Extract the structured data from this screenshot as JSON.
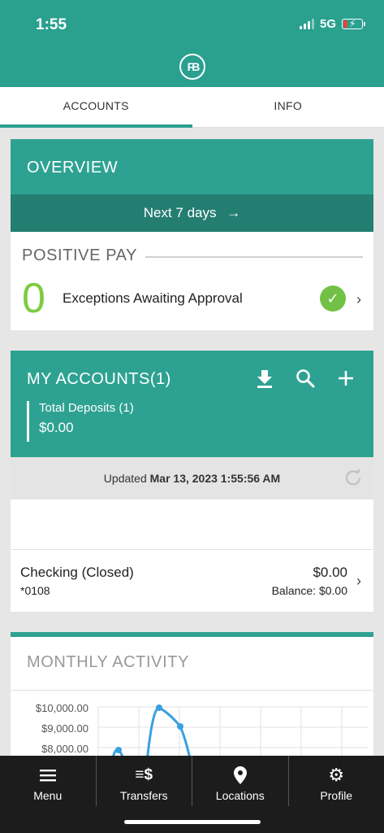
{
  "status": {
    "time": "1:55",
    "network": "5G"
  },
  "tabs": [
    {
      "label": "ACCOUNTS",
      "active": true
    },
    {
      "label": "INFO",
      "active": false
    }
  ],
  "overview": {
    "title": "OVERVIEW",
    "next_days": "Next 7 days",
    "positive_pay": {
      "title": "POSITIVE PAY",
      "count": "0",
      "label": "Exceptions Awaiting Approval"
    }
  },
  "accounts": {
    "title": "MY ACCOUNTS(1)",
    "total_label": "Total Deposits (1)",
    "total_amount": "$0.00",
    "updated_prefix": "Updated",
    "updated_time": "Mar 13, 2023 1:55:56 AM",
    "rows": [
      {
        "name": "Checking (Closed)",
        "number": "*0108",
        "amount": "$0.00",
        "balance": "Balance: $0.00"
      }
    ]
  },
  "activity": {
    "title": "MONTHLY ACTIVITY",
    "chart_data": {
      "type": "line",
      "title": "",
      "y_tick_labels": [
        "$10,000.00",
        "$9,000.00",
        "$8,000.00"
      ],
      "note": "partially visible"
    }
  },
  "nav": [
    {
      "label": "Menu",
      "icon": "menu-icon"
    },
    {
      "label": "Transfers",
      "icon": "transfers-icon"
    },
    {
      "label": "Locations",
      "icon": "location-pin-icon"
    },
    {
      "label": "Profile",
      "icon": "gear-icon"
    }
  ],
  "colors": {
    "teal": "#2ea292",
    "teal_dark": "#237e71",
    "green": "#7ccc3f",
    "nav_bg": "#1c1c1c"
  }
}
